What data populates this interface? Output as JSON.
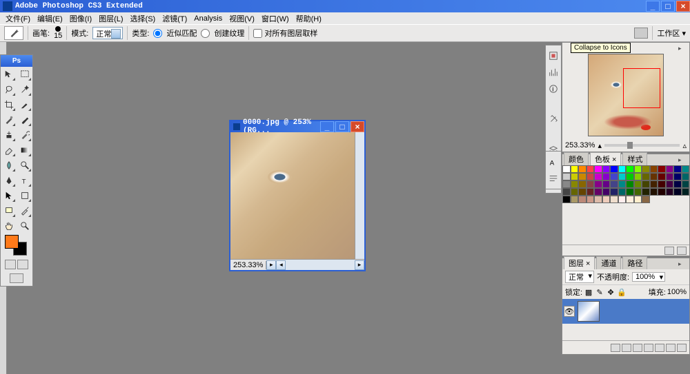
{
  "titlebar": {
    "title": "Adobe Photoshop CS3 Extended"
  },
  "menu": {
    "file": "文件(F)",
    "edit": "编辑(E)",
    "image": "图像(I)",
    "layer": "图层(L)",
    "select": "选择(S)",
    "filter": "滤镜(T)",
    "analysis": "Analysis",
    "view": "视图(V)",
    "window": "窗口(W)",
    "help": "帮助(H)"
  },
  "options": {
    "brush_label": "画笔:",
    "brush_size": "15",
    "mode_label": "模式:",
    "blend_mode": "正常",
    "type_label": "类型:",
    "radio_approx": "近似匹配",
    "radio_create": "创建纹理",
    "check_sample": "对所有图层取样",
    "workspace_label": "工作区 ▾"
  },
  "doc": {
    "title": "0000.jpg @ 253%(RG...",
    "zoom": "253.33%"
  },
  "nav": {
    "tooltip": "Collapse to Icons",
    "zoom": "253.33%"
  },
  "swatches": {
    "tabs": {
      "color": "颜色",
      "swatches": "色板 ×",
      "styles": "样式"
    }
  },
  "layers": {
    "tabs": {
      "layers": "图层 ×",
      "channels": "通道",
      "paths": "路径"
    },
    "blend": "正常",
    "opacity_label": "不透明度:",
    "opacity_val": "100%",
    "lock_label": "锁定:",
    "fill_label": "填充:",
    "fill_val": "100%"
  }
}
